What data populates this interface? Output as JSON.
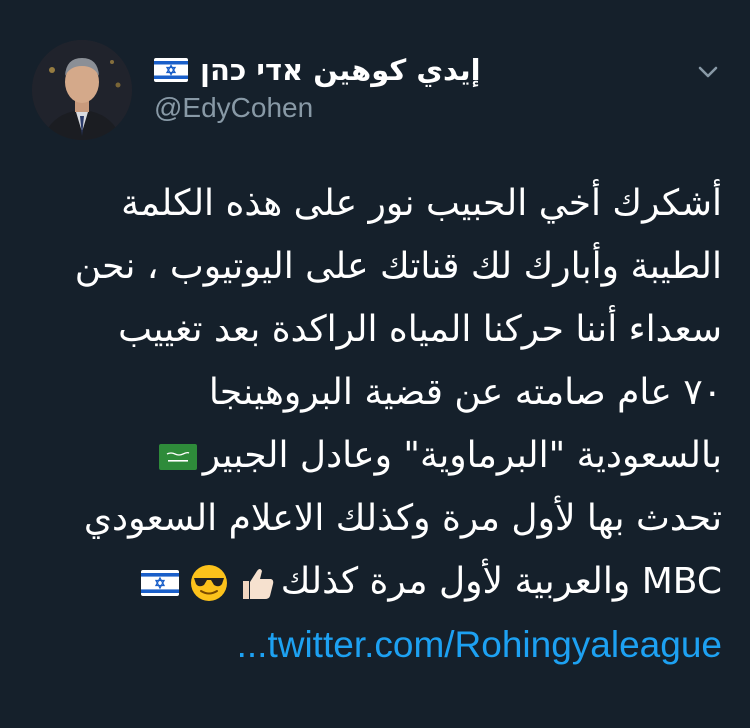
{
  "author": {
    "display_name": "إيدي كوهين אדי כהן",
    "handle": "@EdyCohen",
    "flag_icon": "israel-flag-icon"
  },
  "tweet": {
    "lines": [
      "أشكرك أخي الحبيب نور على هذه الكلمة",
      "الطيبة وأبارك لك قناتك على اليوتيوب ، نحن",
      "سعداء أننا حركنا المياه الراكدة بعد تغييب",
      "٧٠ عام صامته عن قضية البروهينجا",
      "بالسعودية \"البرماوية\" وعادل الجبير",
      "تحدث بها لأول مرة وكذلك الاعلام السعودي",
      "MBC والعربية لأول مرة كذلك"
    ],
    "link_text": "...twitter.com/Rohingyaleague",
    "emojis": [
      "thumbs-up-icon",
      "sunglasses-face-icon",
      "israel-flag-icon"
    ],
    "line5_flag": "saudi-flag-icon"
  },
  "colors": {
    "background": "#15202b",
    "primary_text": "#ffffff",
    "secondary_text": "#8899a6",
    "link": "#1da1f2"
  }
}
